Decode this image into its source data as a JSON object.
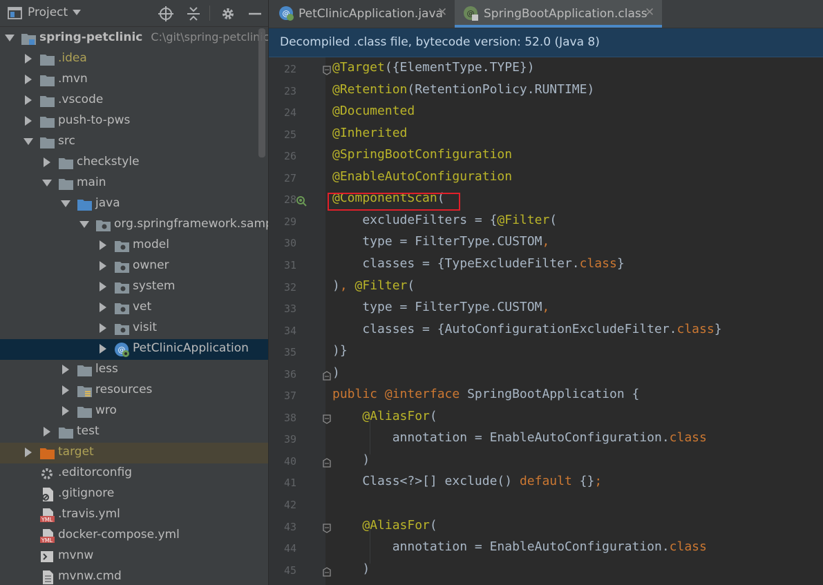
{
  "project_panel": {
    "title": "Project",
    "tree": [
      {
        "label": "spring-petclinic",
        "sub": "C:\\git\\spring-petclinic",
        "kind": "module",
        "expanded": true
      },
      {
        "label": ".idea",
        "kind": "folder",
        "expanded": false,
        "gold": true
      },
      {
        "label": ".mvn",
        "kind": "folder",
        "expanded": false
      },
      {
        "label": ".vscode",
        "kind": "folder",
        "expanded": false
      },
      {
        "label": "push-to-pws",
        "kind": "folder",
        "expanded": false
      },
      {
        "label": "src",
        "kind": "folder",
        "expanded": true
      },
      {
        "label": "checkstyle",
        "kind": "folder",
        "expanded": false
      },
      {
        "label": "main",
        "kind": "folder",
        "expanded": true
      },
      {
        "label": "java",
        "kind": "source-folder",
        "expanded": true
      },
      {
        "label": "org.springframework.samples.petclinic",
        "kind": "package",
        "expanded": true
      },
      {
        "label": "model",
        "kind": "package",
        "expanded": false
      },
      {
        "label": "owner",
        "kind": "package",
        "expanded": false
      },
      {
        "label": "system",
        "kind": "package",
        "expanded": false
      },
      {
        "label": "vet",
        "kind": "package",
        "expanded": false
      },
      {
        "label": "visit",
        "kind": "package",
        "expanded": false
      },
      {
        "label": "PetClinicApplication",
        "kind": "spring-class",
        "expanded": false,
        "selected": true
      },
      {
        "label": "less",
        "kind": "folder",
        "expanded": false
      },
      {
        "label": "resources",
        "kind": "resources-folder",
        "expanded": false
      },
      {
        "label": "wro",
        "kind": "folder",
        "expanded": false
      },
      {
        "label": "test",
        "kind": "folder",
        "expanded": false
      },
      {
        "label": "target",
        "kind": "excluded-folder",
        "expanded": false,
        "gold": true,
        "highlighted": true
      },
      {
        "label": ".editorconfig",
        "kind": "gear-file"
      },
      {
        "label": ".gitignore",
        "kind": "ignore-file"
      },
      {
        "label": ".travis.yml",
        "kind": "yml-file"
      },
      {
        "label": "docker-compose.yml",
        "kind": "yml-file"
      },
      {
        "label": "mvnw",
        "kind": "script-file"
      },
      {
        "label": "mvnw.cmd",
        "kind": "text-file"
      }
    ]
  },
  "tabs": [
    {
      "label": "PetClinicApplication.java",
      "active": false
    },
    {
      "label": "SpringBootApplication.class",
      "active": true
    }
  ],
  "banner": "Decompiled .class file, bytecode version: 52.0 (Java 8)",
  "editor": {
    "lines": [
      {
        "num": "22",
        "segments": [
          {
            "t": "@Target",
            "c": "ann"
          },
          {
            "t": "({ElementType.TYPE})"
          }
        ],
        "fold": "start"
      },
      {
        "num": "23",
        "segments": [
          {
            "t": "@Retention",
            "c": "ann"
          },
          {
            "t": "(RetentionPolicy.RUNTIME)"
          }
        ]
      },
      {
        "num": "24",
        "segments": [
          {
            "t": "@Documented",
            "c": "ann"
          }
        ]
      },
      {
        "num": "25",
        "segments": [
          {
            "t": "@Inherited",
            "c": "ann"
          }
        ]
      },
      {
        "num": "26",
        "segments": [
          {
            "t": "@SpringBootConfiguration",
            "c": "ann"
          }
        ]
      },
      {
        "num": "27",
        "segments": [
          {
            "t": "@EnableAutoConfiguration",
            "c": "ann"
          }
        ]
      },
      {
        "num": "28",
        "segments": [
          {
            "t": "@ComponentScan",
            "c": "ann"
          },
          {
            "t": "("
          }
        ],
        "marker": true
      },
      {
        "num": "29",
        "segments": [
          {
            "t": "    excludeFilters = {"
          },
          {
            "t": "@Filter",
            "c": "ann"
          },
          {
            "t": "("
          }
        ]
      },
      {
        "num": "30",
        "segments": [
          {
            "t": "    type = FilterType.CUSTOM"
          },
          {
            "t": ",",
            "c": "kw"
          }
        ]
      },
      {
        "num": "31",
        "segments": [
          {
            "t": "    classes = {TypeExcludeFilter."
          },
          {
            "t": "class",
            "c": "kw"
          },
          {
            "t": "}"
          }
        ]
      },
      {
        "num": "32",
        "segments": [
          {
            "t": ")"
          },
          {
            "t": ", ",
            "c": "kw"
          },
          {
            "t": "@Filter",
            "c": "ann"
          },
          {
            "t": "("
          }
        ]
      },
      {
        "num": "33",
        "segments": [
          {
            "t": "    type = FilterType.CUSTOM"
          },
          {
            "t": ",",
            "c": "kw"
          }
        ]
      },
      {
        "num": "34",
        "segments": [
          {
            "t": "    classes = {AutoConfigurationExcludeFilter."
          },
          {
            "t": "class",
            "c": "kw"
          },
          {
            "t": "}"
          }
        ]
      },
      {
        "num": "35",
        "segments": [
          {
            "t": ")}"
          }
        ]
      },
      {
        "num": "36",
        "segments": [
          {
            "t": ")"
          }
        ],
        "fold": "end"
      },
      {
        "num": "37",
        "segments": [
          {
            "t": "public ",
            "c": "kw"
          },
          {
            "t": "@interface ",
            "c": "kw"
          },
          {
            "t": "SpringBootApplication {"
          }
        ]
      },
      {
        "num": "38",
        "segments": [
          {
            "t": "    "
          },
          {
            "t": "@AliasFor",
            "c": "ann"
          },
          {
            "t": "("
          }
        ],
        "fold": "start"
      },
      {
        "num": "39",
        "segments": [
          {
            "t": "        annotation = EnableAutoConfiguration."
          },
          {
            "t": "class",
            "c": "kw"
          }
        ]
      },
      {
        "num": "40",
        "segments": [
          {
            "t": "    )"
          }
        ],
        "fold": "end"
      },
      {
        "num": "41",
        "segments": [
          {
            "t": "    Class<?>[] exclude() "
          },
          {
            "t": "default ",
            "c": "kw"
          },
          {
            "t": "{}"
          },
          {
            "t": ";",
            "c": "kw"
          }
        ]
      },
      {
        "num": "42",
        "segments": []
      },
      {
        "num": "43",
        "segments": [
          {
            "t": "    "
          },
          {
            "t": "@AliasFor",
            "c": "ann"
          },
          {
            "t": "("
          }
        ],
        "fold": "start"
      },
      {
        "num": "44",
        "segments": [
          {
            "t": "        annotation = EnableAutoConfiguration."
          },
          {
            "t": "class",
            "c": "kw"
          }
        ]
      },
      {
        "num": "45",
        "segments": [
          {
            "t": "    )"
          }
        ],
        "fold": "end"
      }
    ]
  },
  "colors": {
    "annotation": "#bbb529",
    "keyword": "#cc7832",
    "text": "#a9b7c6",
    "highlight_box": "#e0202a",
    "active_tab_underline": "#4a88c7",
    "banner_background": "#1e3d59"
  }
}
